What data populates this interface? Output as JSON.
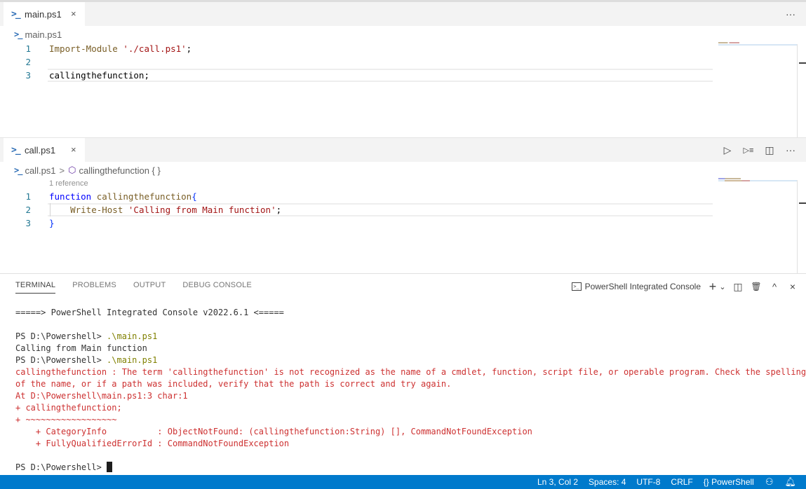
{
  "editor_groups": [
    {
      "tab": {
        "label": "main.ps1",
        "icon": "powershell-icon",
        "close": "×"
      },
      "actions": {
        "more": "···"
      },
      "breadcrumb": {
        "file": "main.ps1"
      },
      "lines": [
        {
          "num": "1",
          "tokens": [
            {
              "t": "Import-Module ",
              "c": "cmd"
            },
            {
              "t": "'./call.ps1'",
              "c": "str"
            },
            {
              "t": ";",
              "c": "plain"
            }
          ]
        },
        {
          "num": "2",
          "tokens": []
        },
        {
          "num": "3",
          "tokens": [
            {
              "t": "callingthefunction;",
              "c": "plain"
            }
          ],
          "current": true
        }
      ]
    },
    {
      "tab": {
        "label": "call.ps1",
        "icon": "powershell-icon",
        "close": "×"
      },
      "actions": {
        "run": "▷",
        "run_selection": "▷≡",
        "split": "◫",
        "more": "···"
      },
      "breadcrumb": {
        "file": "call.ps1",
        "separator": ">",
        "symbol": "callingthefunction { }"
      },
      "codelens": "1 reference",
      "lines": [
        {
          "num": "1",
          "tokens": [
            {
              "t": "function ",
              "c": "kw"
            },
            {
              "t": "callingthefunction",
              "c": "fn"
            },
            {
              "t": "{",
              "c": "brace"
            }
          ]
        },
        {
          "num": "2",
          "tokens": [
            {
              "t": "    Write-Host ",
              "c": "cmd"
            },
            {
              "t": "'Calling from Main function'",
              "c": "str"
            },
            {
              "t": ";",
              "c": "plain"
            }
          ],
          "current": true
        },
        {
          "num": "3",
          "tokens": [
            {
              "t": "}",
              "c": "brace"
            }
          ]
        }
      ]
    }
  ],
  "panel": {
    "tabs": [
      {
        "label": "TERMINAL",
        "active": true
      },
      {
        "label": "PROBLEMS",
        "active": false
      },
      {
        "label": "OUTPUT",
        "active": false
      },
      {
        "label": "DEBUG CONSOLE",
        "active": false
      }
    ],
    "terminal_selector": "PowerShell Integrated Console",
    "actions": {
      "new": "+",
      "dropdown": "⌄",
      "split": "◫",
      "kill": "🗑",
      "maximize": "^",
      "close": "×"
    },
    "terminal_lines": [
      {
        "text": "=====> PowerShell Integrated Console v2022.6.1 <=====",
        "type": "normal"
      },
      {
        "text": "",
        "type": "normal"
      },
      {
        "prompt": "PS D:\\Powershell> ",
        "cmd": ".\\main.ps1",
        "type": "prompt"
      },
      {
        "text": "Calling from Main function",
        "type": "normal"
      },
      {
        "prompt": "PS D:\\Powershell> ",
        "cmd": ".\\main.ps1",
        "type": "prompt"
      },
      {
        "text": "callingthefunction : The term 'callingthefunction' is not recognized as the name of a cmdlet, function, script file, or operable program. Check the spelling",
        "type": "err"
      },
      {
        "text": "of the name, or if a path was included, verify that the path is correct and try again.",
        "type": "err"
      },
      {
        "text": "At D:\\Powershell\\main.ps1:3 char:1",
        "type": "err"
      },
      {
        "text": "+ callingthefunction;",
        "type": "err"
      },
      {
        "text": "+ ~~~~~~~~~~~~~~~~~~",
        "type": "err"
      },
      {
        "text": "    + CategoryInfo          : ObjectNotFound: (callingthefunction:String) [], CommandNotFoundException",
        "type": "err"
      },
      {
        "text": "    + FullyQualifiedErrorId : CommandNotFoundException",
        "type": "err"
      },
      {
        "text": "",
        "type": "normal"
      },
      {
        "prompt": "PS D:\\Powershell> ",
        "cmd": "",
        "type": "prompt",
        "cursor": true
      }
    ]
  },
  "statusbar": {
    "position": "Ln 3, Col 2",
    "spaces": "Spaces: 4",
    "encoding": "UTF-8",
    "eol": "CRLF",
    "language": "PowerShell",
    "language_icon": "{}"
  },
  "colors": {
    "statusbar_bg": "#007acc",
    "error": "#cd3131",
    "keyword": "#0000ff",
    "string": "#a31515",
    "command": "#795e26",
    "line_number": "#237893"
  }
}
